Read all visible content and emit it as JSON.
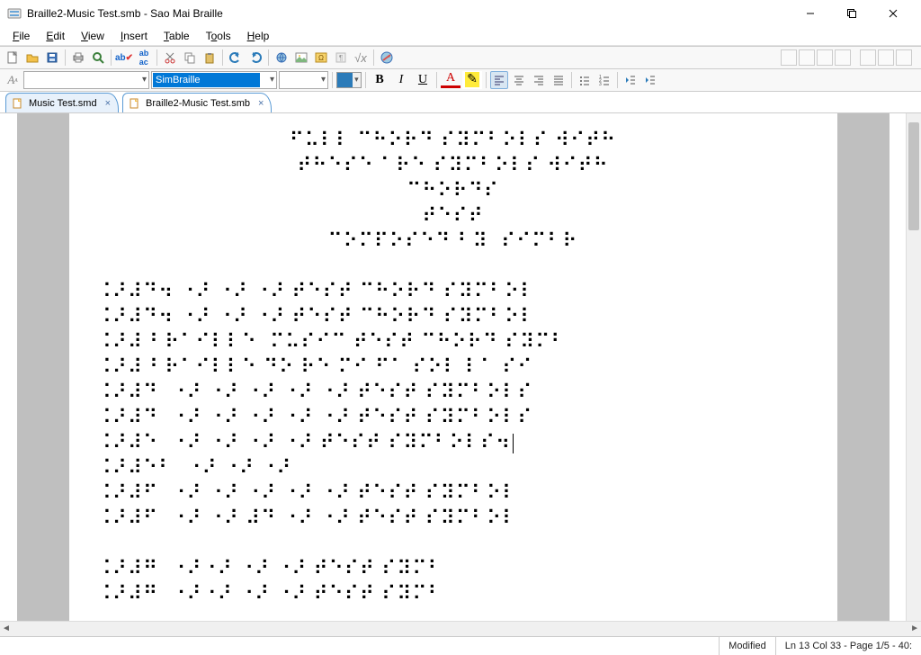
{
  "window": {
    "title": "Braille2-Music Test.smb - Sao Mai Braille"
  },
  "menu": {
    "file": "File",
    "edit": "Edit",
    "view": "View",
    "insert": "Insert",
    "table": "Table",
    "tools": "Tools",
    "help": "Help"
  },
  "toolbar2": {
    "font_select": "",
    "style_select": "SimBraille",
    "size_select": "",
    "bold": "B",
    "italic": "I",
    "underline": "U",
    "color_a": "A",
    "highlight_a": "A"
  },
  "tabs": [
    {
      "label": "Music Test.smd",
      "active": false
    },
    {
      "label": "Braille2-Music Test.smb",
      "active": true
    }
  ],
  "braille_lines": [
    {
      "align": "center",
      "text": "⠋⠥⠇⠇ ⠉⠓⠕⠗⠙ ⠎⠽⠍⠃⠕⠇⠎ ⠺⠊⠞⠓"
    },
    {
      "align": "center",
      "text": "⠞⠓⠑⠎⠑ ⠁⠗⠑ ⠎⠽⠍⠃⠕⠇⠎ ⠺⠊⠞⠓"
    },
    {
      "align": "center",
      "text": "⠉⠓⠕⠗⠙⠎"
    },
    {
      "align": "center",
      "text": "⠞⠑⠎⠞"
    },
    {
      "align": "center",
      "text": "⠉⠕⠍⠏⠕⠎⠑⠙ ⠃⠽  ⠎⠊⠍⠃⠗"
    },
    {
      "align": "left",
      "text": ""
    },
    {
      "align": "left",
      "text": " ⠨⠜⠼⠙⠲ ⠐⠜ ⠐⠜ ⠐⠜ ⠞⠑⠎⠞ ⠉⠓⠕⠗⠙ ⠎⠽⠍⠃⠕⠇"
    },
    {
      "align": "left",
      "text": " ⠨⠜⠼⠙⠲ ⠐⠜ ⠐⠜ ⠐⠜ ⠞⠑⠎⠞ ⠉⠓⠕⠗⠙ ⠎⠽⠍⠃⠕⠇"
    },
    {
      "align": "left",
      "text": " ⠨⠜⠼ ⠃⠗⠁⠊⠇⠇⠑  ⠍⠥⠎⠊⠉ ⠞⠑⠎⠞ ⠉⠓⠕⠗⠙ ⠎⠽⠍⠃"
    },
    {
      "align": "left",
      "text": " ⠨⠜⠼ ⠃⠗⠁⠊⠇⠇⠑ ⠙⠕ ⠗⠑ ⠍⠊ ⠋⠁ ⠎⠕⠇ ⠇⠁ ⠎⠊"
    },
    {
      "align": "left",
      "text": " ⠨⠜⠼⠙  ⠐⠜ ⠐⠜ ⠐⠜ ⠐⠜ ⠐⠜ ⠞⠑⠎⠞ ⠎⠽⠍⠃⠕⠇⠎"
    },
    {
      "align": "left",
      "text": " ⠨⠜⠼⠙  ⠐⠜ ⠐⠜ ⠐⠜ ⠐⠜ ⠐⠜ ⠞⠑⠎⠞ ⠎⠽⠍⠃⠕⠇⠎"
    },
    {
      "align": "left",
      "text": " ⠨⠜⠼⠑  ⠐⠜ ⠐⠜ ⠐⠜ ⠐⠜ ⠞⠑⠎⠞ ⠎⠽⠍⠃⠕⠇⠎⠲",
      "cursor": true
    },
    {
      "align": "left",
      "text": " ⠨⠜⠼⠑⠃  ⠐⠜ ⠐⠜ ⠐⠜"
    },
    {
      "align": "left",
      "text": " ⠨⠜⠼⠋  ⠐⠜ ⠐⠜ ⠐⠜ ⠐⠜ ⠐⠜ ⠞⠑⠎⠞ ⠎⠽⠍⠃⠕⠇"
    },
    {
      "align": "left",
      "text": " ⠨⠜⠼⠋  ⠐⠜ ⠐⠜ ⠼⠙ ⠐⠜ ⠐⠜ ⠞⠑⠎⠞ ⠎⠽⠍⠃⠕⠇"
    },
    {
      "align": "left",
      "text": ""
    },
    {
      "align": "left",
      "text": " ⠨⠜⠼⠛  ⠐⠜⠐⠜ ⠐⠜ ⠐⠜ ⠞⠑⠎⠞ ⠎⠽⠍⠃"
    },
    {
      "align": "left",
      "text": " ⠨⠜⠼⠛  ⠐⠜⠐⠜ ⠐⠜ ⠐⠜ ⠞⠑⠎⠞ ⠎⠽⠍⠃"
    }
  ],
  "status": {
    "modified": "Modified",
    "pos": "Ln 13 Col 33 - Page 1/5 - 40:"
  }
}
